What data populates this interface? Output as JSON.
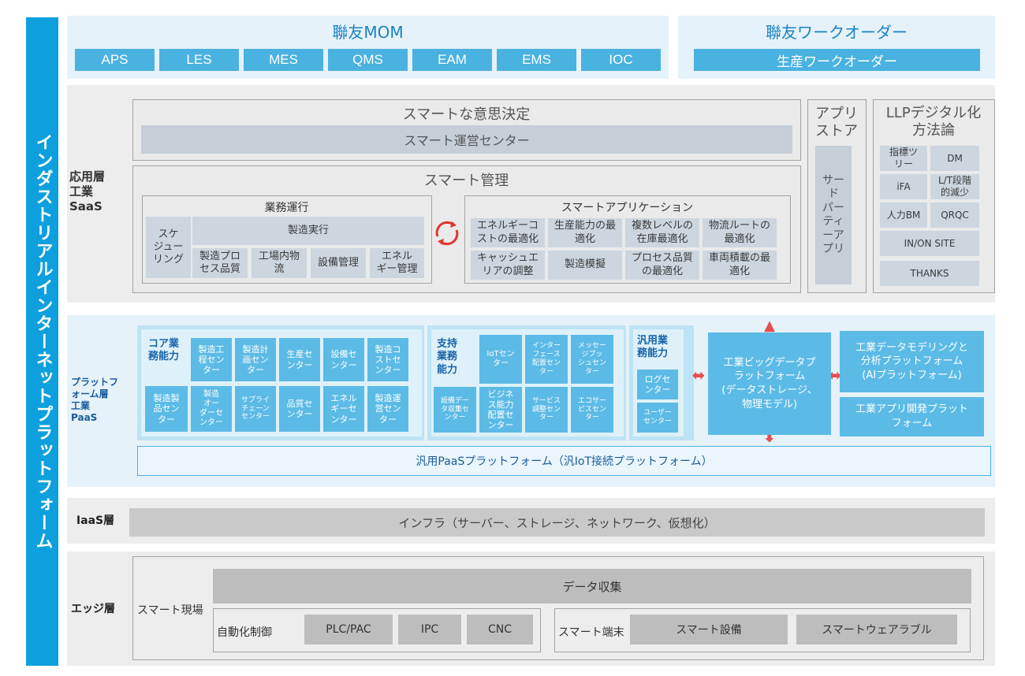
{
  "side_title": "インダストリアルインターネットプラットフォーム",
  "mom": {
    "title": "聯友MOM",
    "modules": [
      "APS",
      "LES",
      "MES",
      "QMS",
      "EAM",
      "EMS",
      "IOC"
    ]
  },
  "workorder": {
    "title": "聯友ワークオーダー",
    "module": "生産ワークオーダー"
  },
  "saas": {
    "label": "応用層\n工業\nSaaS",
    "decision": {
      "title": "スマートな意思決定",
      "center": "スマート運営センター"
    },
    "management": {
      "title": "スマート管理",
      "business": {
        "title": "業務運行",
        "scheduling": "スケ\nジュー\nリング",
        "manufacturing": "製造実行",
        "items": [
          "製造プロ\nセス品質",
          "工場内物\n流",
          "設備管理",
          "エネル\nギー管理"
        ]
      },
      "apps": {
        "title": "スマートアプリケーション",
        "items": [
          "エネルギーコ\nストの最適化",
          "生産能力の最\n適化",
          "複数レベルの\n在庫最適化",
          "物流ルートの\n最適化",
          "キャッシュエ\nリアの調整",
          "製造模擬",
          "プロセス品質\nの最適化",
          "車両積載の最\n適化"
        ]
      }
    },
    "appstore": {
      "title": "アプリ\nストア",
      "item": "サー\nド\nパー\nティ\nーア\nプリ"
    },
    "llp": {
      "title": "LLPデジタル化\n方法論",
      "items": [
        "指標ツ\nリー",
        "DM",
        "iFA",
        "L/T段階\n的減少",
        "人力BM",
        "QRQC"
      ],
      "wide": [
        "IN/ON SITE",
        "THANKS"
      ]
    }
  },
  "paas": {
    "label": "プラットフ\nォーム層\n工業\nPaaS",
    "core": {
      "title": "コア業\n務能力",
      "top": [
        "製造工\n程セン\nター",
        "製造計\n画セン\nター",
        "生産セ\nンター",
        "設備セ\nンター",
        "製造コ\nストセ\nンター"
      ],
      "bottom": [
        "製造製\n品セン\nター",
        "製造\nオー\nダーセ\nンター",
        "サプライ\nチェーン\nセンター",
        "品質セ\nンター",
        "エネル\nギーセ\nンター",
        "製造運\n営セン\nター"
      ]
    },
    "support": {
      "title": "支持\n業務\n能力",
      "top": [
        "IoTセン\nター",
        "インター\nフェース\n配置セン\nター",
        "メッセー\nジプッ\nシュセン\nター"
      ],
      "bottom": [
        "設備デー\nタ収集セ\nンター",
        "ビジネ\nス能力\n配置セ\nンター",
        "サービス\n調整セン\nター",
        "エコサー\nビスセン\nター"
      ]
    },
    "general": {
      "title": "汎用業\n務能力",
      "items": [
        "ログセ\nンター",
        "ユーザー\nセンター"
      ]
    },
    "bigdata": "工業ビッグデータプ\nラットフォーム\n(データストレージ、\n物理モデル)",
    "modeling": "工業データモデリングと\n分析プラットフォーム\n(AIプラットフォーム)",
    "appdev": "工業アプリ開発プラット\nフォーム",
    "base": "汎用PaaSプラットフォーム（汎IoT接続プラットフォーム）"
  },
  "iaas": {
    "label": "IaaS層",
    "content": "インフラ（サーバー、ストレージ、ネットワーク、仮想化）"
  },
  "edge": {
    "label": "エッジ層",
    "field": "スマート現場",
    "collect": "データ収集",
    "auto": {
      "label": "自動化制御",
      "items": [
        "PLC/PAC",
        "IPC",
        "CNC"
      ]
    },
    "terminal": {
      "label": "スマート端末",
      "items": [
        "スマート設備",
        "スマートウェアラブル"
      ]
    }
  },
  "colors": {
    "primary": "#0ea0de",
    "accent_red": "#e84d4d"
  }
}
